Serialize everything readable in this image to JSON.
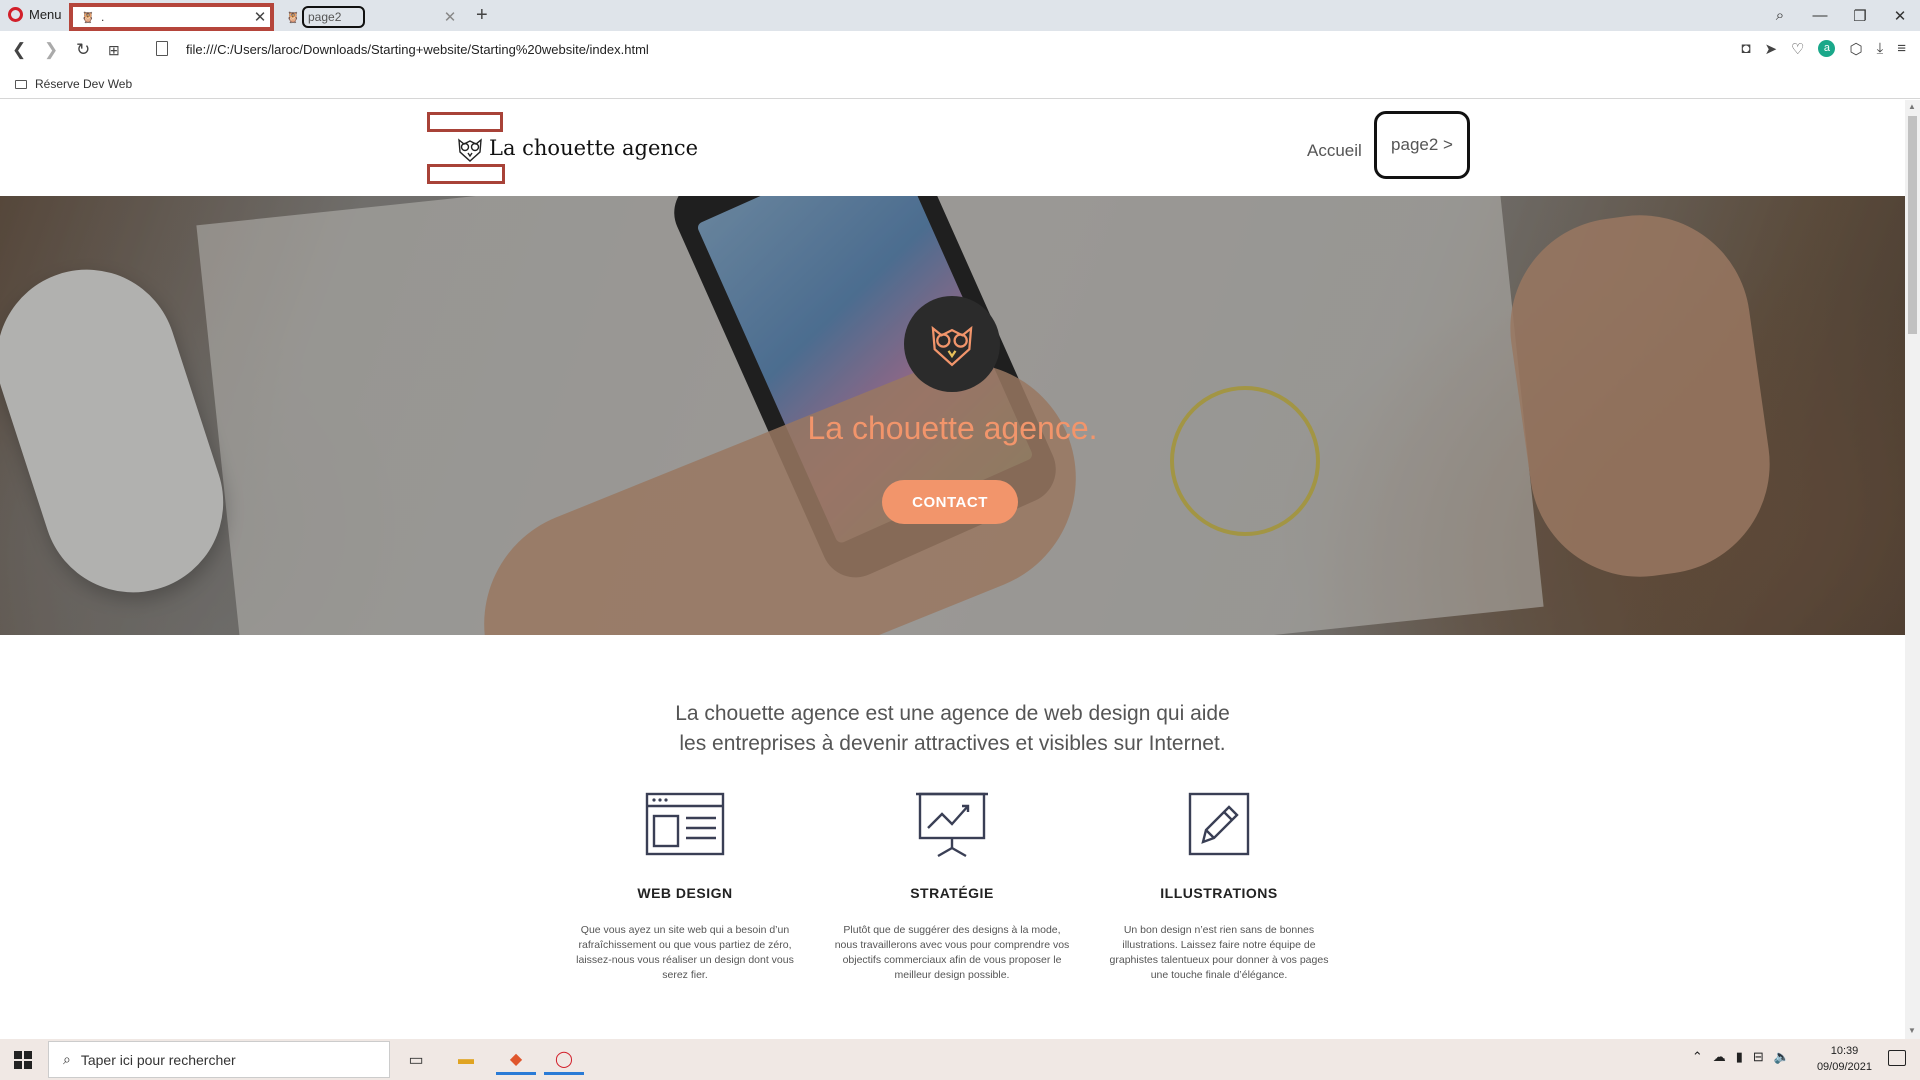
{
  "browser": {
    "menu_label": "Menu",
    "tabs": [
      {
        "title": "."
      },
      {
        "title": "page2"
      }
    ],
    "new_tab": "+",
    "url": "file:///C:/Users/laroc/Downloads/Starting+website/Starting%20website/index.html",
    "bookmark": "Réserve Dev Web"
  },
  "site": {
    "logo_text": "La chouette agence",
    "nav": {
      "home": "Accueil",
      "page2": "page2 >"
    },
    "hero": {
      "title": "La chouette agence.",
      "cta": "CONTACT"
    },
    "intro_line1": "La chouette agence est une agence de web design qui aide",
    "intro_line2": "les entreprises à devenir attractives et visibles sur Internet.",
    "features": [
      {
        "name": "WEB DESIGN",
        "icon": "web-layout-icon",
        "desc": "Que vous ayez un site web qui a besoin d’un rafraîchissement ou que vous partiez de zéro, laissez-nous vous réaliser un design dont vous serez fier."
      },
      {
        "name": "STRATÉGIE",
        "icon": "presentation-chart-icon",
        "desc": "Plutôt que de suggérer des designs à la mode, nous travaillerons avec vous pour comprendre vos objectifs commerciaux afin de vous proposer le meilleur design possible."
      },
      {
        "name": "ILLUSTRATIONS",
        "icon": "pencil-icon",
        "desc": "Un bon design n’est rien sans de bonnes illustrations. Laissez faire notre équipe de graphistes talentueux pour donner à vos pages une touche finale d’élégance."
      }
    ],
    "accent_color": "#f2956b"
  },
  "taskbar": {
    "search_placeholder": "Taper ici pour rechercher",
    "time": "10:39",
    "date": "09/09/2021"
  }
}
